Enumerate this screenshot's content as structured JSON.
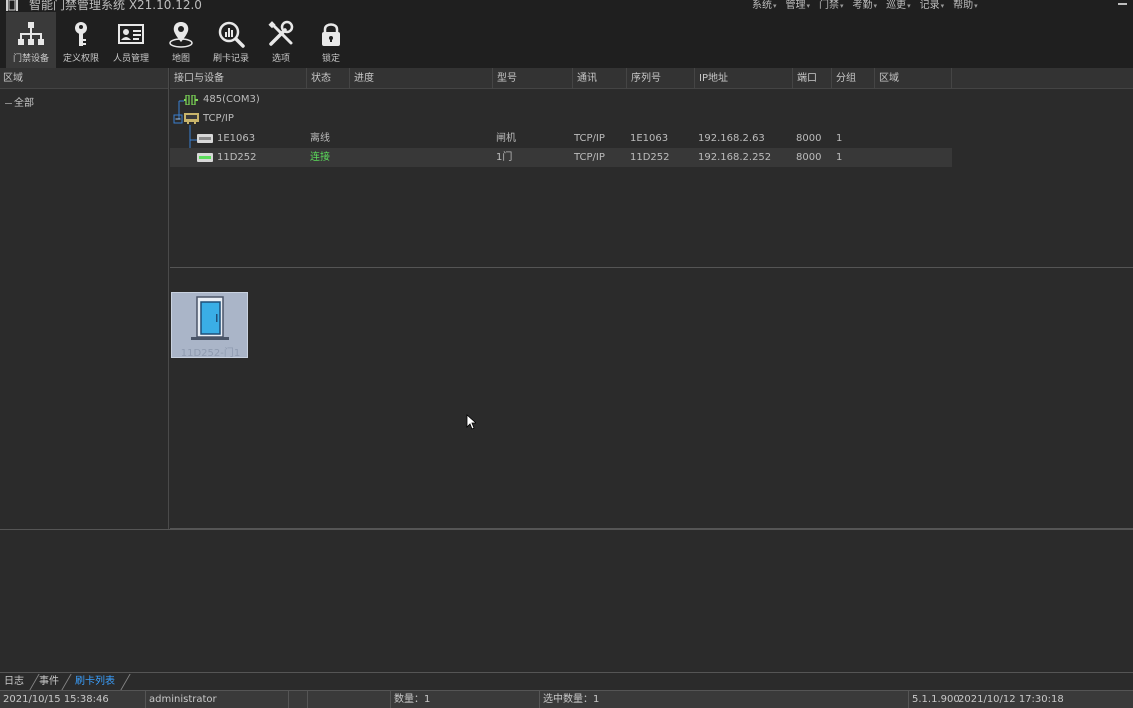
{
  "app": {
    "title": "智能门禁管理系统 X21.10.12.0"
  },
  "menu": [
    {
      "label": "系统"
    },
    {
      "label": "管理"
    },
    {
      "label": "门禁"
    },
    {
      "label": "考勤"
    },
    {
      "label": "巡更"
    },
    {
      "label": "记录"
    },
    {
      "label": "帮助"
    }
  ],
  "toolbar": [
    {
      "label": "门禁设备",
      "icon": "network-tree-icon"
    },
    {
      "label": "定义权限",
      "icon": "key-icon"
    },
    {
      "label": "人员管理",
      "icon": "id-card-icon"
    },
    {
      "label": "地图",
      "icon": "map-pin-icon"
    },
    {
      "label": "刷卡记录",
      "icon": "chart-search-icon"
    },
    {
      "label": "选项",
      "icon": "tools-icon"
    },
    {
      "label": "锁定",
      "icon": "lock-icon"
    }
  ],
  "region": {
    "header": "区域",
    "root": "全部"
  },
  "table": {
    "columns": [
      "接口与设备",
      "状态",
      "进度",
      "型号",
      "通讯",
      "序列号",
      "IP地址",
      "端口",
      "分组",
      "区域"
    ],
    "interfaces": [
      "485(COM3)",
      "TCP/IP"
    ],
    "devices": [
      {
        "name": "1E1063",
        "status": "离线",
        "progress": "",
        "model": "闸机",
        "comm": "TCP/IP",
        "serial": "1E1063",
        "ip": "192.168.2.63",
        "port": "8000",
        "group": "1",
        "region": ""
      },
      {
        "name": "11D252",
        "status": "连接",
        "progress": "",
        "model": "1门",
        "comm": "TCP/IP",
        "serial": "11D252",
        "ip": "192.168.2.252",
        "port": "8000",
        "group": "1",
        "region": ""
      }
    ]
  },
  "door": {
    "label": "11D252-门1"
  },
  "tabs": [
    "日志",
    "事件",
    "刷卡列表"
  ],
  "status": {
    "datetime": "2021/10/15 15:38:46",
    "user": "administrator",
    "count": "数量：1",
    "selected": "选中数量：1",
    "version": "5.1.1.900",
    "build_date": "2021/10/12 17:30:18"
  },
  "colors": {
    "online": "#5bdc5b",
    "active_tab": "#3aa0ff",
    "door_card": "#aab5c8"
  }
}
